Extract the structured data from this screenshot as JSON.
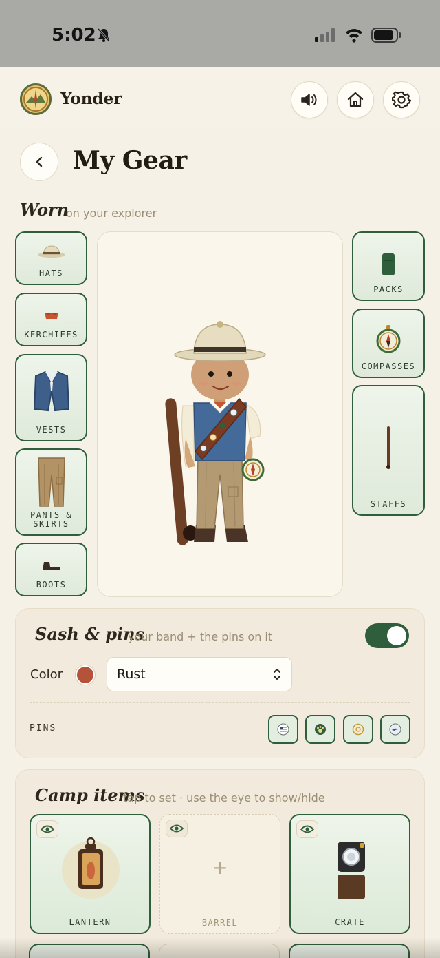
{
  "status_bar": {
    "time": "5:02"
  },
  "header": {
    "app_name": "Yonder"
  },
  "page": {
    "title": "My Gear"
  },
  "worn": {
    "label": "Worn",
    "sub": "on your explorer",
    "left_slots": [
      "HATS",
      "KERCHIEFS",
      "VESTS",
      "PANTS & SKIRTS",
      "BOOTS"
    ],
    "right_slots": [
      "PACKS",
      "COMPASSES",
      "STAFFS"
    ]
  },
  "sash": {
    "title": "Sash & pins",
    "sub": "your band + the pins on it",
    "toggle_on": true,
    "color_label": "Color",
    "color_value": "Rust",
    "color_hex": "#b5533a",
    "pins_label": "PINS",
    "pins": [
      "flag-pin",
      "paw-pin",
      "sun-pin",
      "bird-pin"
    ]
  },
  "camp": {
    "title": "Camp items",
    "sub": "tap to set · use the eye to show/hide",
    "items": [
      "LANTERN",
      "BARREL",
      "CRATE"
    ],
    "add_symbol": "+"
  },
  "colors": {
    "accent": "#2f5e3c",
    "background": "#f6f1e6"
  }
}
